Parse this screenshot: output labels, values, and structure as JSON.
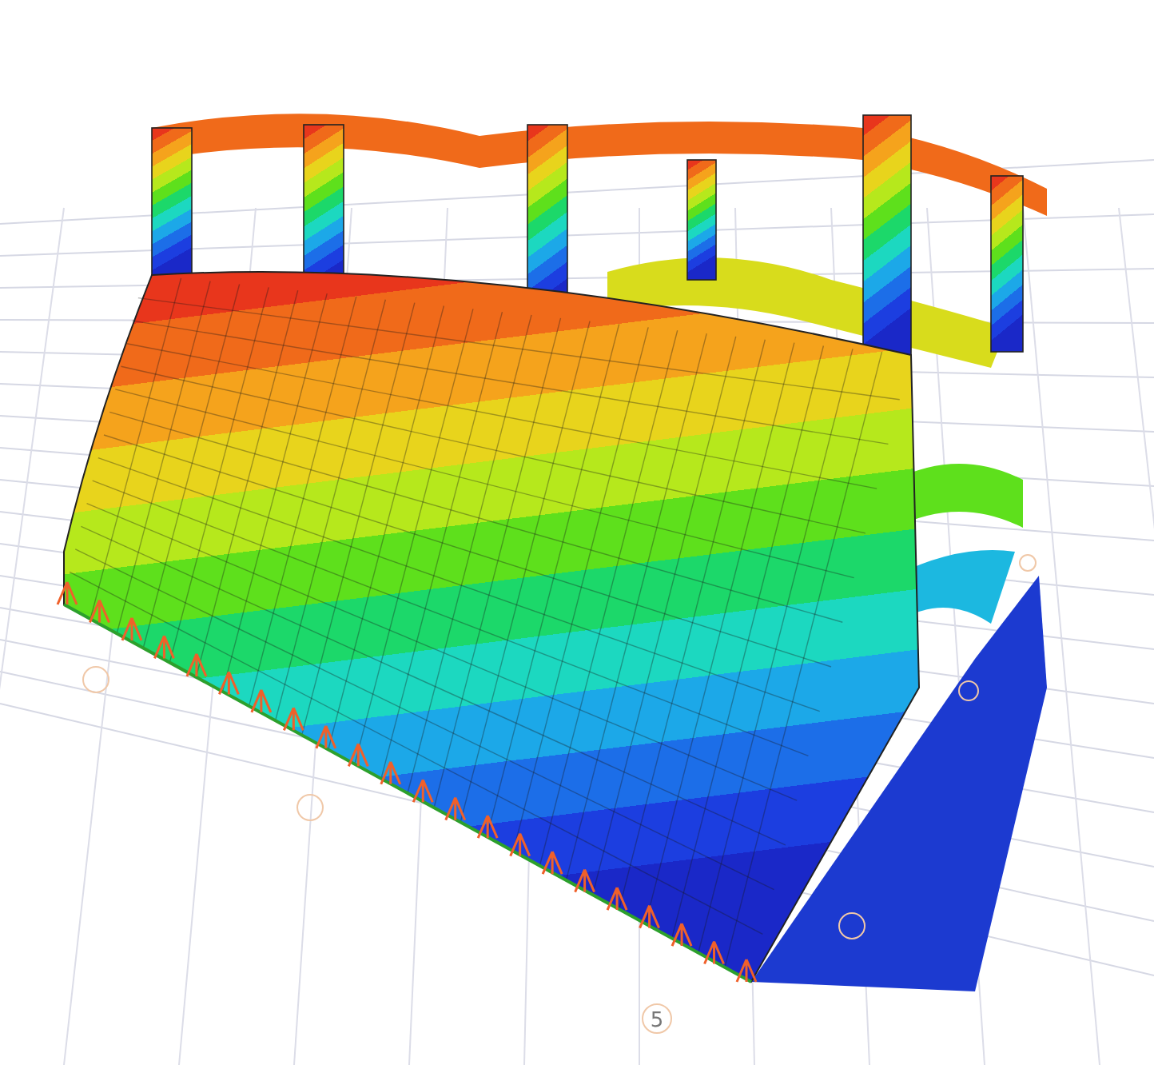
{
  "viewport": {
    "grid_label": "5"
  }
}
